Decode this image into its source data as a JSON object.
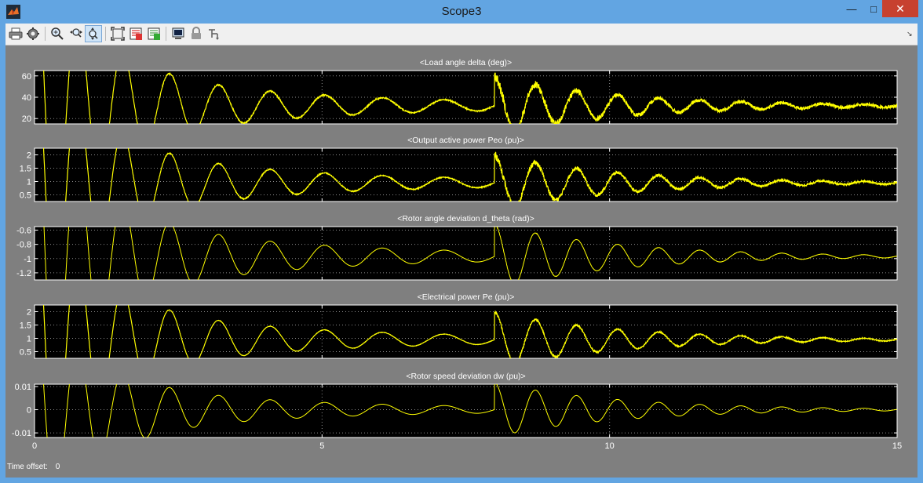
{
  "window": {
    "title": "Scope3"
  },
  "toolbar": {
    "buttons": [
      {
        "name": "print-icon"
      },
      {
        "name": "parameters-icon"
      },
      {
        "name": "zoom-in-icon"
      },
      {
        "name": "zoom-x-icon"
      },
      {
        "name": "zoom-y-icon"
      },
      {
        "name": "autoscale-icon"
      },
      {
        "name": "save-axes-icon"
      },
      {
        "name": "restore-axes-icon"
      },
      {
        "name": "floating-scope-icon"
      },
      {
        "name": "lock-icon"
      },
      {
        "name": "signal-selection-icon"
      }
    ],
    "menu_glyph": "↘"
  },
  "colors": {
    "plot_bg": "#000000",
    "trace": "#ffff00",
    "figure_bg": "#808080",
    "text": "#ffffff"
  },
  "status": {
    "time_offset_label": "Time offset:",
    "time_offset_value": "0"
  },
  "chart_data": [
    {
      "type": "line",
      "title": "<Load angle  delta  (deg)>",
      "xlim": [
        0,
        15
      ],
      "ylim": [
        15,
        65
      ],
      "yticks": [
        "60",
        "40",
        "20"
      ],
      "xticks": [],
      "base": 32,
      "amp_pre": 19,
      "amp_post": 21,
      "noise": 2.5,
      "grid": true
    },
    {
      "type": "line",
      "title": "<Output active power  Peo (pu)>",
      "xlim": [
        0,
        15
      ],
      "ylim": [
        0.25,
        2.25
      ],
      "yticks": [
        "2",
        "1.5",
        "1",
        "0.5"
      ],
      "xticks": [],
      "base": 0.95,
      "amp_pre": 0.7,
      "amp_post": 0.8,
      "noise": 0.07,
      "grid": true
    },
    {
      "type": "line",
      "title": "<Rotor angle deviation  d_theta (rad)>",
      "xlim": [
        0,
        15
      ],
      "ylim": [
        -1.3,
        -0.55
      ],
      "yticks": [
        "-0.6",
        "-0.8",
        "-1",
        "-1.2"
      ],
      "xticks": [],
      "base": -0.97,
      "amp_pre": 0.3,
      "amp_post": 0.35,
      "noise": 0.003,
      "grid": true
    },
    {
      "type": "line",
      "title": "<Electrical power  Pe (pu)>",
      "xlim": [
        0,
        15
      ],
      "ylim": [
        0.25,
        2.25
      ],
      "yticks": [
        "2",
        "1.5",
        "1",
        "0.5"
      ],
      "xticks": [],
      "base": 0.95,
      "amp_pre": 0.7,
      "amp_post": 0.8,
      "noise": 0.03,
      "grid": true
    },
    {
      "type": "line",
      "title": "<Rotor speed deviation  dw (pu)>",
      "xlim": [
        0,
        15
      ],
      "ylim": [
        -0.012,
        0.011
      ],
      "yticks": [
        "0.01",
        "0",
        "-0.01"
      ],
      "xticks": [
        "0",
        "5",
        "10",
        "15"
      ],
      "base": 0,
      "amp_pre": 0.006,
      "amp_post": 0.009,
      "noise": 0,
      "grid": true
    }
  ]
}
